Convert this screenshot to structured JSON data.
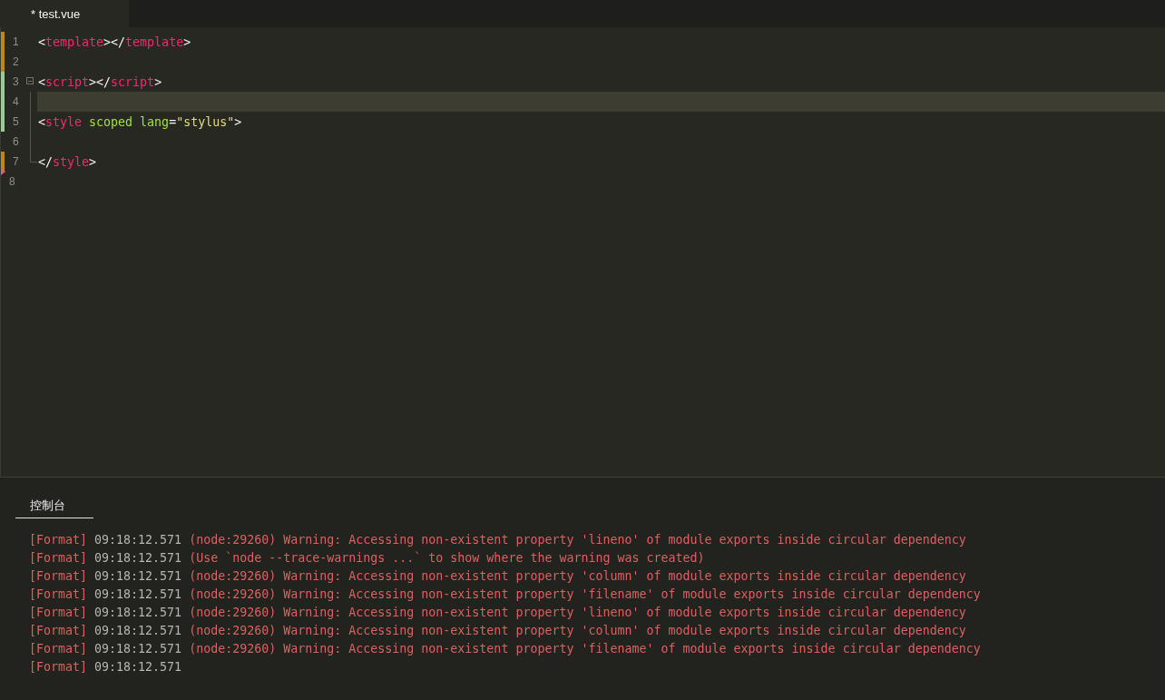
{
  "tabs": [
    {
      "label": "* test.vue",
      "selected": true
    }
  ],
  "editor": {
    "lines": [
      {
        "number": "1",
        "color": "#c3870f",
        "kind": "bar",
        "tokens": [
          {
            "kind": "punct",
            "text": "<"
          },
          {
            "kind": "tag",
            "text": "template"
          },
          {
            "kind": "punct",
            "text": "></"
          },
          {
            "kind": "tag",
            "text": "template"
          },
          {
            "kind": "punct",
            "text": ">"
          }
        ]
      },
      {
        "number": "2",
        "color": "#c3870f",
        "kind": "bar"
      },
      {
        "number": "3",
        "color": "#9bcb94",
        "kind": "bar",
        "fold": true,
        "tokens": [
          {
            "kind": "punct",
            "text": "<"
          },
          {
            "kind": "tag",
            "text": "script"
          },
          {
            "kind": "punct",
            "text": "></"
          },
          {
            "kind": "tag",
            "text": "script"
          },
          {
            "kind": "punct",
            "text": ">"
          }
        ]
      },
      {
        "number": "4",
        "color": "#9bcb94",
        "kind": "bar",
        "current": true,
        "guide": true
      },
      {
        "number": "5",
        "color": "#9bcb94",
        "kind": "bar",
        "guide": true,
        "tokens": [
          {
            "kind": "punct",
            "text": "<"
          },
          {
            "kind": "tag",
            "text": "style"
          },
          {
            "kind": "attr",
            "text": " scoped"
          },
          {
            "kind": "attr",
            "text": " lang"
          },
          {
            "kind": "punct",
            "text": "="
          },
          {
            "kind": "string",
            "text": "\"stylus\""
          },
          {
            "kind": "punct",
            "text": ">"
          }
        ]
      },
      {
        "number": "6",
        "guide": true
      },
      {
        "number": "7",
        "color": "#c3870f",
        "kind": "bar",
        "guide": true,
        "tokens": [
          {
            "kind": "punct",
            "text": "</"
          },
          {
            "kind": "tag",
            "text": "style"
          },
          {
            "kind": "punct",
            "text": ">"
          }
        ]
      },
      {
        "number": "8",
        "color": "#d9637a",
        "kind": "triangle"
      }
    ]
  },
  "console": {
    "tabs": [
      {
        "label": "控制台",
        "selected": true
      }
    ],
    "lines": [
      {
        "source": "[Format]",
        "time": "09:18:12.571",
        "message": "(node:29260) Warning: Accessing non-existent property 'lineno' of module exports inside circular dependency"
      },
      {
        "source": "[Format]",
        "time": "09:18:12.571",
        "message": "(Use `node --trace-warnings ...` to show where the warning was created)"
      },
      {
        "source": "[Format]",
        "time": "09:18:12.571",
        "message": "(node:29260) Warning: Accessing non-existent property 'column' of module exports inside circular dependency"
      },
      {
        "source": "[Format]",
        "time": "09:18:12.571",
        "message": "(node:29260) Warning: Accessing non-existent property 'filename' of module exports inside circular dependency"
      },
      {
        "source": "[Format]",
        "time": "09:18:12.571",
        "message": "(node:29260) Warning: Accessing non-existent property 'lineno' of module exports inside circular dependency"
      },
      {
        "source": "[Format]",
        "time": "09:18:12.571",
        "message": "(node:29260) Warning: Accessing non-existent property 'column' of module exports inside circular dependency"
      },
      {
        "source": "[Format]",
        "time": "09:18:12.571",
        "message": "(node:29260) Warning: Accessing non-existent property 'filename' of module exports inside circular dependency"
      },
      {
        "source": "[Format]",
        "time": "09:18:12.571"
      }
    ]
  }
}
